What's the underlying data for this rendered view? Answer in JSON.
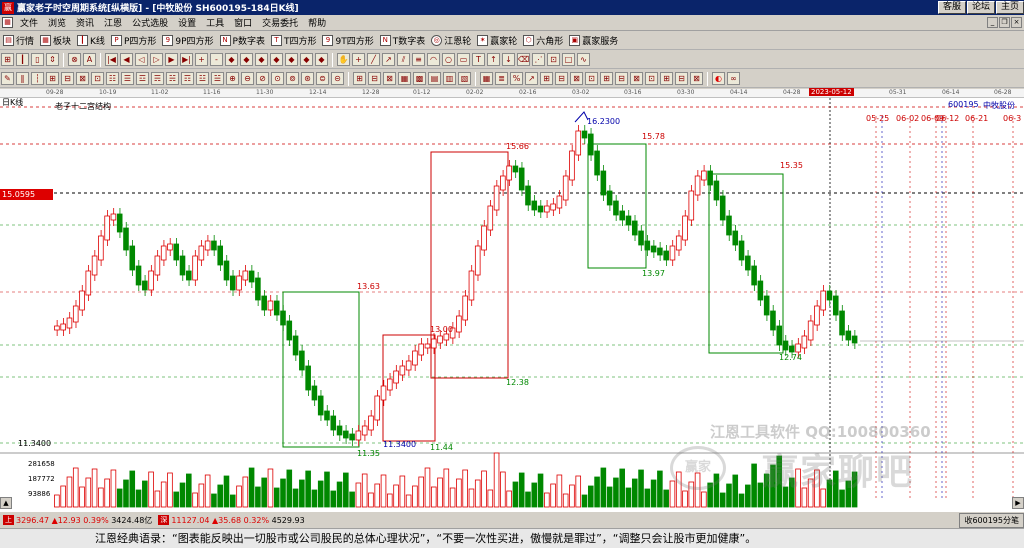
{
  "window": {
    "title": "赢家老子时空周期系统[纵横版] - [中牧股份  SH600195-184日K线]",
    "buttons": [
      "客服",
      "论坛",
      "主页"
    ]
  },
  "menu": [
    "文件",
    "浏览",
    "资讯",
    "江恩",
    "公式选股",
    "设置",
    "工具",
    "窗口",
    "交易委托",
    "帮助"
  ],
  "toolbar1": [
    {
      "icon": "chart-icon",
      "label": "行情"
    },
    {
      "icon": "grid-icon",
      "label": "板块"
    },
    {
      "icon": "candle-icon",
      "label": "K线"
    },
    {
      "icon": "p-icon",
      "label": "P四方形"
    },
    {
      "icon": "9p-icon",
      "label": "9P四方形"
    },
    {
      "icon": "pn-icon",
      "label": "P数字表"
    },
    {
      "icon": "t-icon",
      "label": "T四方形"
    },
    {
      "icon": "9t-icon",
      "label": "9T四方形"
    },
    {
      "icon": "tn-icon",
      "label": "T数字表"
    },
    {
      "icon": "gann-wheel-icon",
      "label": "江恩轮"
    },
    {
      "icon": "winner-wheel-icon",
      "label": "赢家轮"
    },
    {
      "icon": "hexagon-icon",
      "label": "六角形"
    },
    {
      "icon": "service-icon",
      "label": "赢家服务"
    }
  ],
  "datebar": {
    "dates": [
      "09-28",
      "10-19",
      "11-02",
      "11-16",
      "11-30",
      "12-14",
      "12-28",
      "01-12",
      "02-02",
      "02-16",
      "03-02",
      "03-16",
      "03-30",
      "04-14",
      "04-28",
      "05-31",
      "06-14",
      "06-28"
    ],
    "highlight": "2023-05-12"
  },
  "chart": {
    "period_label": "日K线",
    "indicator_title": "老子十二宫结构",
    "stock_code": "600195",
    "stock_name": "中牧股份",
    "current_price_tag": "15.0595",
    "low_axis_label": "11.3400",
    "future_dates": [
      "05-25",
      "06-02",
      "06-09",
      "06-12",
      "06-21",
      "06-3"
    ],
    "volume_axis": [
      "281658",
      "187772",
      "93886"
    ],
    "levels": {
      "l1": "13.63",
      "l2": "13.00",
      "l3": "11.35",
      "l4": "11.3400",
      "l5": "11.44",
      "l6": "15.66",
      "l7": "12.38",
      "l8": "16.2300",
      "l9": "15.78",
      "l10": "13.97",
      "l11": "15.35",
      "l12": "12.74"
    }
  },
  "watermark": {
    "line1": "江恩工具软件  QQ:100800360",
    "logo": "赢家",
    "big": "赢家聊吧"
  },
  "status": {
    "sh_tag": "上",
    "sh_index": "3296.47",
    "sh_change": "▲12.93",
    "sh_pct": "0.39%",
    "sh_amount": "3424.48亿",
    "sz_tag": "深",
    "sz_index": "11127.04",
    "sz_change": "▲35.68",
    "sz_pct": "0.32%",
    "sz_amount": "4529.93",
    "right": "收600195分笔"
  },
  "quote": "江恩经典语录：“图表能反映出一切股市或公司股民的总体心理状况”，“不要一次性买进，傲慢就是罪过”，“调整只会让股市更加健康”。"
}
